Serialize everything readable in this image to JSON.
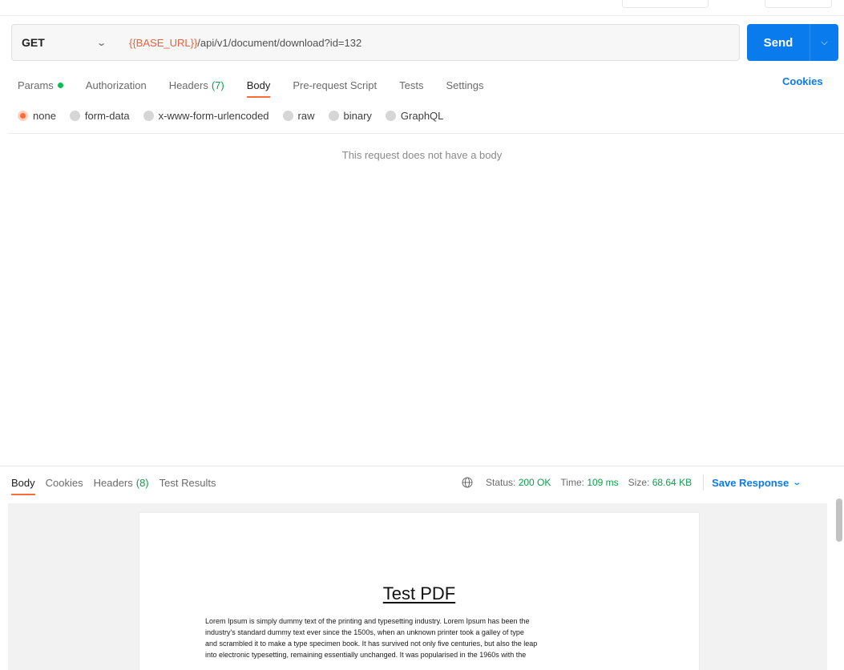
{
  "request": {
    "method": "GET",
    "url_variable": "{{BASE_URL}}",
    "url_path": "/api/v1/document/download?id=132",
    "send_label": "Send"
  },
  "request_tabs": [
    {
      "label": "Params",
      "indicator": "green-dot"
    },
    {
      "label": "Authorization"
    },
    {
      "label": "Headers",
      "count": "(7)"
    },
    {
      "label": "Body",
      "active": true
    },
    {
      "label": "Pre-request Script"
    },
    {
      "label": "Tests"
    },
    {
      "label": "Settings"
    }
  ],
  "cookies_label": "Cookies",
  "body_types": [
    {
      "label": "none",
      "selected": true
    },
    {
      "label": "form-data"
    },
    {
      "label": "x-www-form-urlencoded"
    },
    {
      "label": "raw"
    },
    {
      "label": "binary"
    },
    {
      "label": "GraphQL"
    }
  ],
  "empty_body_message": "This request does not have a body",
  "response": {
    "tabs": [
      {
        "label": "Body",
        "active": true
      },
      {
        "label": "Cookies"
      },
      {
        "label": "Headers",
        "count": "(8)"
      },
      {
        "label": "Test Results"
      }
    ],
    "status_label": "Status:",
    "status_value": "200 OK",
    "time_label": "Time:",
    "time_value": "109 ms",
    "size_label": "Size:",
    "size_value": "68.64 KB",
    "save_label": "Save Response"
  },
  "pdf": {
    "title": "Test PDF",
    "lines": [
      "Lorem Ipsum is simply dummy text of the printing and typesetting industry. Lorem Ipsum has been the",
      "industry's standard dummy text ever since the 1500s, when an unknown printer took a galley of type",
      "and scrambled it to make a type specimen book. It has survived not only five centuries, but also the leap",
      "into electronic typesetting, remaining essentially unchanged. It was popularised in the 1960s with the"
    ]
  },
  "colors": {
    "accent_orange": "#ff6c37",
    "send_blue": "#097bed",
    "status_green": "#0c9d4a"
  }
}
